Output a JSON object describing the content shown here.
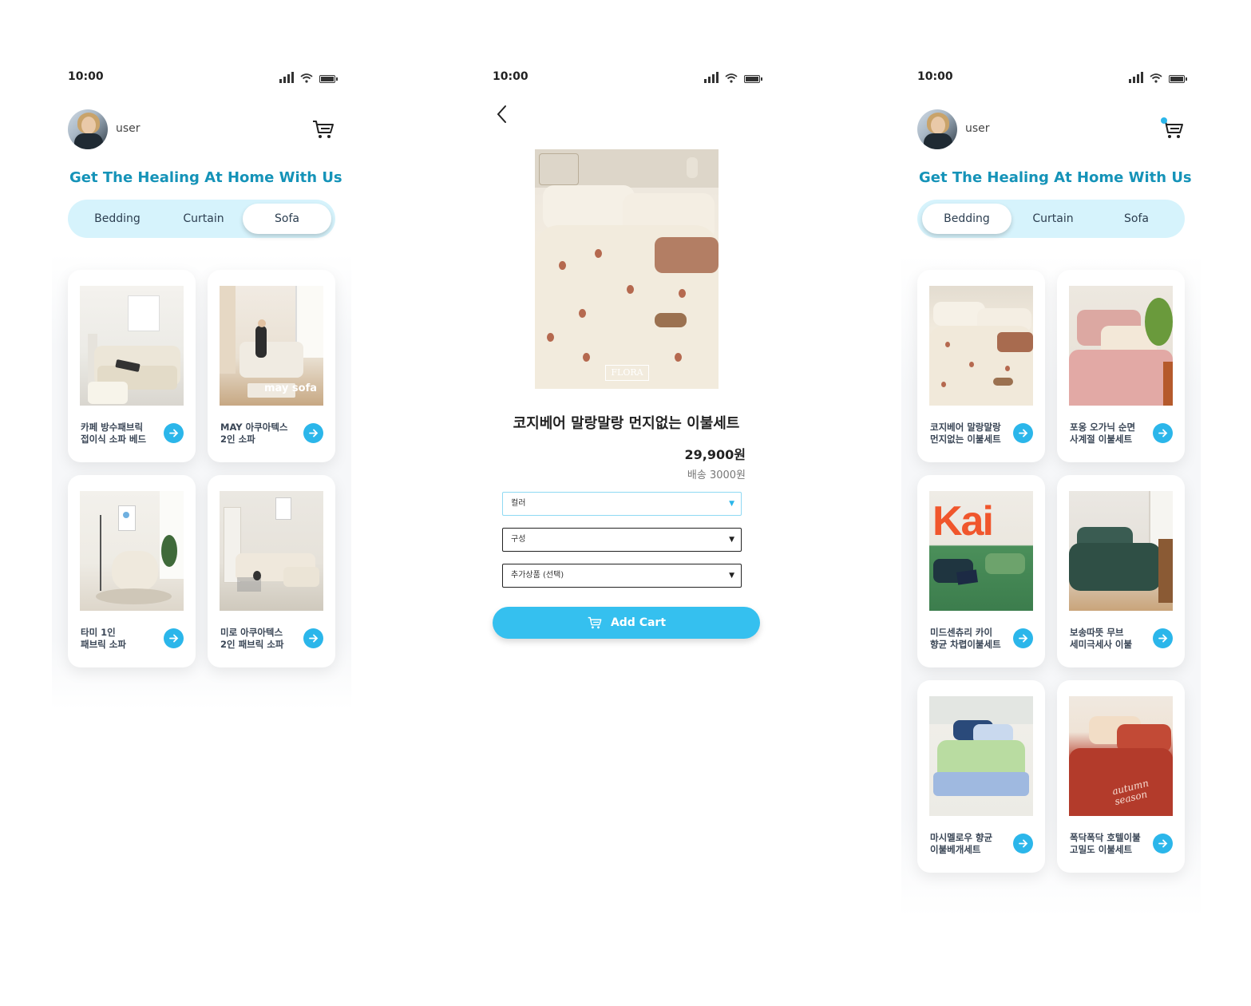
{
  "screens": {
    "home_sofa": {
      "status_time": "10:00",
      "username": "user",
      "tagline": "Get The Healing At Home With Us",
      "tabs": [
        "Bedding",
        "Curtain",
        "Sofa"
      ],
      "active_tab": "Sofa",
      "products": [
        {
          "name": "카페 방수패브릭\n접이식 소파 베드",
          "image": "sofa-bed-photo"
        },
        {
          "name": "MAY 아쿠아텍스\n2인 소파",
          "image": "may-sofa-photo",
          "overlay_text": "may sofa"
        },
        {
          "name": "타미 1인\n패브릭 소파",
          "image": "armchair-photo"
        },
        {
          "name": "미로 아쿠아텍스\n2인 패브릭 소파",
          "image": "sectional-sofa-photo"
        }
      ]
    },
    "product_detail": {
      "status_time": "10:00",
      "title": "코지베어 말랑말랑 먼지없는 이불세트",
      "price": "29,900원",
      "shipping": "배송 3000원",
      "hero_brand": "FLORA",
      "options": [
        {
          "label": "컬러",
          "focused": true
        },
        {
          "label": "구성",
          "focused": false
        },
        {
          "label": "추가상품 (선택)",
          "focused": false
        }
      ],
      "add_cart_label": "Add Cart"
    },
    "home_bedding": {
      "status_time": "10:00",
      "username": "user",
      "tagline": "Get The Healing At Home With Us",
      "tabs": [
        "Bedding",
        "Curtain",
        "Sofa"
      ],
      "active_tab": "Bedding",
      "cart_has_badge": true,
      "products": [
        {
          "name": "코지베어 말랑말랑\n먼지없는 이불세트",
          "image": "bear-bedding-photo"
        },
        {
          "name": "포옹 오가닉 순면\n사계절 이불세트",
          "image": "pink-bedding-photo"
        },
        {
          "name": "미드센츄리 카이\n향균 차렵이불세트",
          "image": "kai-bedding-photo",
          "overlay_text": "Kai"
        },
        {
          "name": "보송따뜻 무브\n세미극세사 이불",
          "image": "green-bedding-photo"
        },
        {
          "name": "마시멜로우 향균\n이불베개세트",
          "image": "mint-bedding-photo"
        },
        {
          "name": "폭닥폭닥 호텔이불\n고밀도 이불세트",
          "image": "red-bedding-photo",
          "overlay_text": "autumn season"
        }
      ]
    }
  },
  "colors": {
    "accent": "#35c0ef",
    "tagline": "#1593b8",
    "tab_bar": "#d6f3fc"
  }
}
